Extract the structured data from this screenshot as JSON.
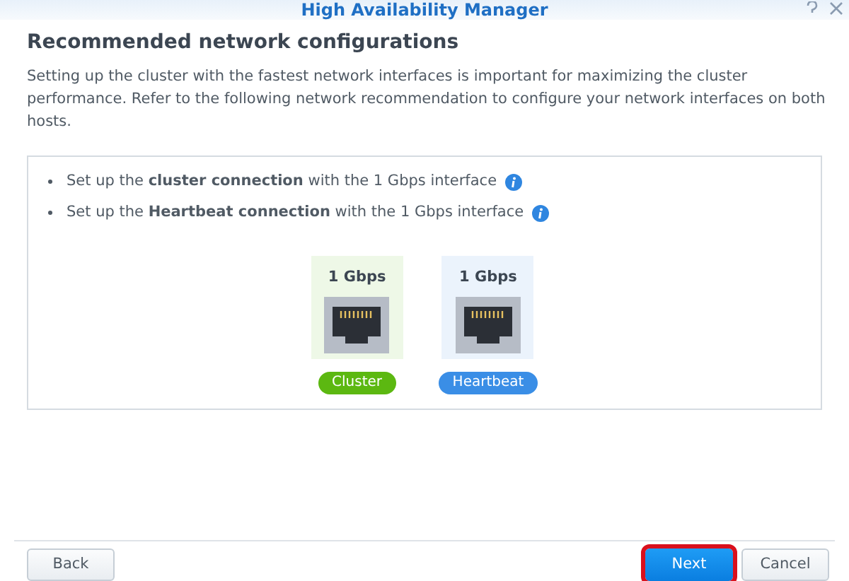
{
  "window": {
    "title": "High Availability Manager"
  },
  "heading": "Recommended network configurations",
  "description": "Setting up the cluster with the fastest network interfaces is important for maximizing the cluster performance. Refer to the following network recommendation to configure your network interfaces on both hosts.",
  "recommendations": [
    "Set up the **cluster connection** with the 1 Gbps interface",
    "Set up the **Heartbeat connection** with the 1 Gbps interface"
  ],
  "ports": [
    {
      "speed": "1 Gbps",
      "label": "Cluster",
      "color": "#5cb811"
    },
    {
      "speed": "1 Gbps",
      "label": "Heartbeat",
      "color": "#3a8ee6"
    }
  ],
  "buttons": [
    {
      "label": "Back",
      "kind": "plain",
      "highlighted": false
    },
    {
      "label": "Next",
      "kind": "primary",
      "highlighted": true
    },
    {
      "label": "Cancel",
      "kind": "plain",
      "highlighted": false
    }
  ]
}
